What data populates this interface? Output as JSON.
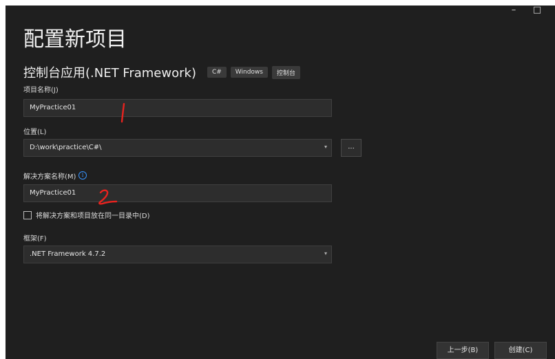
{
  "window_controls": {
    "minimize": "–",
    "maximize": "□",
    "close": "×"
  },
  "header": {
    "title": "配置新项目",
    "subtitle": "控制台应用(.NET Framework)",
    "tags": [
      "C#",
      "Windows",
      "控制台"
    ]
  },
  "form": {
    "project_name": {
      "label": "项目名称(J)",
      "value": "MyPractice01"
    },
    "location": {
      "label": "位置(L)",
      "value": "D:\\work\\practice\\C#\\",
      "browse_label": "..."
    },
    "solution_name": {
      "label": "解决方案名称(M)",
      "value": "MyPractice01",
      "info_icon": "i"
    },
    "same_dir": {
      "label": "将解决方案和项目放在同一目录中(D)",
      "checked": false
    },
    "framework": {
      "label": "框架(F)",
      "value": ".NET Framework 4.7.2"
    }
  },
  "footer": {
    "prev_label": "上一步(B)",
    "create_label": "创建(C)"
  },
  "annotations": {
    "color": "#e8231f"
  },
  "colors": {
    "background": "#1f1f1f",
    "field_bg": "#2d2d2d",
    "accent_info": "#3794ff"
  }
}
